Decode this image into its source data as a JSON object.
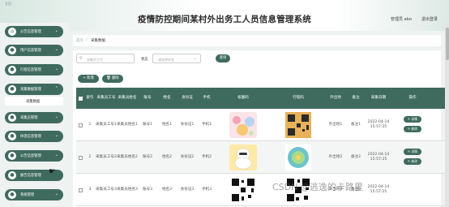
{
  "header": {
    "home_link": "主页",
    "title": "疫情防控期间某村外出务工人员信息管理系统",
    "admin_label": "管理员 abo",
    "logout_label": "退出登录"
  },
  "sidebar": {
    "items": [
      {
        "label": "公告信息管理",
        "icon": "home-icon"
      },
      {
        "label": "用户信息管理",
        "icon": "user-icon"
      },
      {
        "label": "行程信息管理",
        "icon": "user-icon"
      },
      {
        "label": "采集数据管理",
        "icon": "user-icon"
      },
      {
        "label": "采集员管理",
        "icon": "user-icon"
      },
      {
        "label": "体温信息管理",
        "icon": "user-icon"
      },
      {
        "label": "公告信息管理",
        "icon": "user-icon"
      },
      {
        "label": "报告信息管理",
        "icon": "user-icon"
      },
      {
        "label": "系统管理",
        "icon": "user-icon"
      }
    ],
    "active_sub": "采集数据"
  },
  "breadcrumb": {
    "home": "首页",
    "sep": "/",
    "current": "采集数据"
  },
  "search": {
    "placeholder": "采集员工号",
    "status_label": "状态",
    "status_placeholder": "请选择状态",
    "query_button": "查询"
  },
  "actions": {
    "add": "+ 新增",
    "delete": "删除"
  },
  "table": {
    "headers": [
      "",
      "索引",
      "采集员工号",
      "采集员姓名",
      "账号",
      "姓名",
      "身份证",
      "手机",
      "核酸码",
      "行程码",
      "外出地",
      "备注",
      "采集日期",
      "操作"
    ],
    "rows": [
      {
        "idx": "1",
        "worker_no": "采集员工号1",
        "worker_name": "采集员姓名1",
        "account": "账号1",
        "name": "姓名1",
        "id_card": "身份证1",
        "phone": "手机1",
        "dest": "外出地1",
        "note": "备注1",
        "date": "2022-04-14 15:57:25",
        "detail": "详情",
        "edit": "修改"
      },
      {
        "idx": "2",
        "worker_no": "采集员工号2",
        "worker_name": "采集员姓名2",
        "account": "账号2",
        "name": "姓名2",
        "id_card": "身份证2",
        "phone": "手机2",
        "dest": "外出地2",
        "note": "备注2",
        "date": "2022-04-14 15:57:25",
        "detail": "详情",
        "edit": "修改"
      },
      {
        "idx": "3",
        "worker_no": "采集员工号3",
        "worker_name": "采集员姓名3",
        "account": "账号3",
        "name": "姓名3",
        "id_card": "身份证3",
        "phone": "手机3",
        "dest": "外出地3",
        "note": "备注3",
        "date": "2022-04-14 15:57:25",
        "detail": "详情",
        "edit": "修改"
      }
    ]
  },
  "watermark": "CSDN @逃逸的卡路里",
  "colors": {
    "primary": "#3f6b5f",
    "background": "#eef2f1"
  }
}
